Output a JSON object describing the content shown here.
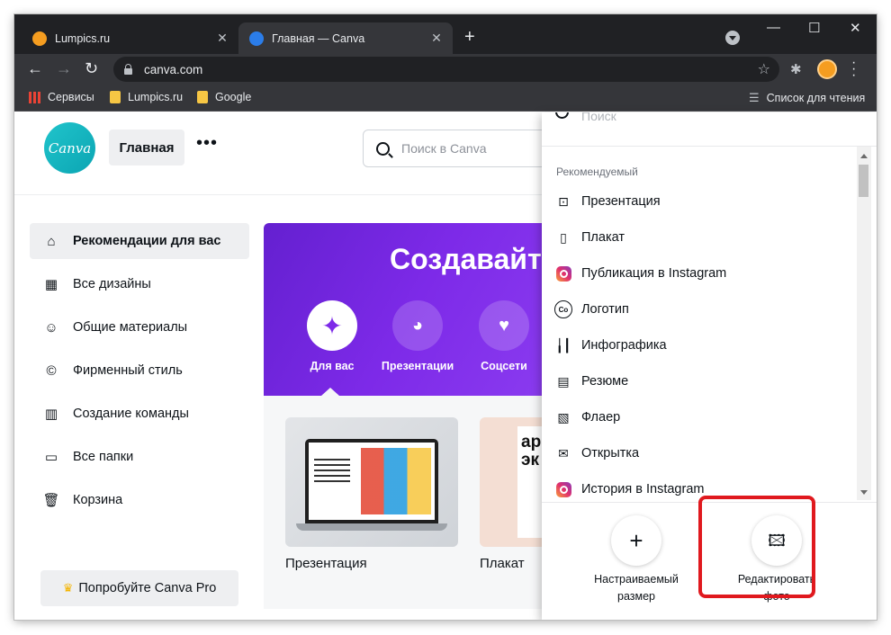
{
  "browser": {
    "tabs": [
      {
        "title": "Lumpics.ru",
        "color": "#f59d20"
      },
      {
        "title": "Главная — Canva",
        "color": "#2b7de9"
      }
    ],
    "url": "canva.com",
    "bookmarks": {
      "services": "Сервисы",
      "lumpics": "Lumpics.ru",
      "google": "Google",
      "reading_list": "Список для чтения"
    }
  },
  "header": {
    "logo_text": "Canva",
    "home_label": "Главная",
    "search_placeholder": "Поиск в Canva"
  },
  "sidebar": {
    "items": [
      {
        "label": "Рекомендации для вас",
        "icon": "home-icon"
      },
      {
        "label": "Все дизайны",
        "icon": "grid-icon"
      },
      {
        "label": "Общие материалы",
        "icon": "users-icon"
      },
      {
        "label": "Фирменный стиль",
        "icon": "brand-icon"
      },
      {
        "label": "Создание команды",
        "icon": "building-icon"
      },
      {
        "label": "Все папки",
        "icon": "folder-icon"
      },
      {
        "label": "Корзина",
        "icon": "trash-icon"
      }
    ],
    "pro_label": "Попробуйте Canva Pro"
  },
  "hero": {
    "title": "Создавайте",
    "categories": [
      {
        "label": "Для вас",
        "icon": "sparkle-icon"
      },
      {
        "label": "Презентации",
        "icon": "presentation-icon"
      },
      {
        "label": "Соцсети",
        "icon": "heart-icon"
      }
    ],
    "accent": "#7d2ae8"
  },
  "cards": [
    {
      "label": "Презентация"
    },
    {
      "label": "Плакат"
    }
  ],
  "poster_text": "ар\nэк",
  "dropdown": {
    "search_placeholder": "Поиск",
    "section": "Рекомендуемый",
    "items": [
      {
        "label": "Презентация",
        "icon": "presentation-icon"
      },
      {
        "label": "Плакат",
        "icon": "poster-icon"
      },
      {
        "label": "Публикация в Instagram",
        "icon": "instagram-icon"
      },
      {
        "label": "Логотип",
        "icon": "logo-icon"
      },
      {
        "label": "Инфографика",
        "icon": "chart-icon"
      },
      {
        "label": "Резюме",
        "icon": "resume-icon"
      },
      {
        "label": "Флаер",
        "icon": "flyer-icon"
      },
      {
        "label": "Открытка",
        "icon": "envelope-icon"
      },
      {
        "label": "История в Instagram",
        "icon": "instagram-icon"
      }
    ],
    "actions": [
      {
        "label_line1": "Настраиваемый",
        "label_line2": "размер",
        "icon": "plus-icon"
      },
      {
        "label_line1": "Редактировать",
        "label_line2": "фото",
        "icon": "photo-edit-icon"
      }
    ],
    "highlight_color": "#e0191e"
  }
}
